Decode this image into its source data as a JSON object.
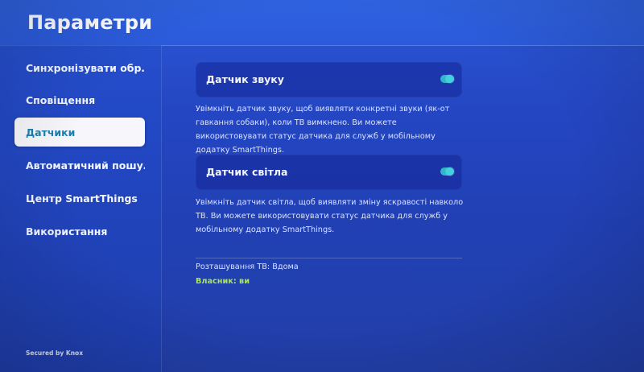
{
  "header": {
    "title": "Параметри"
  },
  "sidebar": {
    "items": [
      {
        "label": "Синхронізувати обр…",
        "selected": false
      },
      {
        "label": "Сповіщення",
        "selected": false
      },
      {
        "label": "Датчики",
        "selected": true
      },
      {
        "label": "Автоматичний пошу…",
        "selected": false
      },
      {
        "label": "Центр SmartThings",
        "selected": false
      },
      {
        "label": "Використання",
        "selected": false
      }
    ],
    "footer": "Secured by Knox"
  },
  "main": {
    "sound_sensor": {
      "label": "Датчик звуку",
      "enabled": true,
      "description": "Увімкніть датчик звуку, щоб виявляти конкретні звуки (як-от гавкання собаки), коли ТВ вимкнено. Ви можете використовувати статус датчика для служб у мобільному додатку SmartThings."
    },
    "light_sensor": {
      "label": "Датчик світла",
      "enabled": true,
      "description": "Увімкніть датчик світла, щоб виявляти зміну яскравості навколо ТВ. Ви можете використовувати статус датчика для служб у мобільному додатку SmartThings."
    },
    "tv_location": "Розташування ТВ: Вдома",
    "owner": "Власник: ви"
  },
  "colors": {
    "background": "#2446c3",
    "accent_toggle": "#43d1e0",
    "selected_text": "#1b7fae",
    "owner_text": "#a8e35a"
  },
  "icons": {
    "toggle": "toggle-switch-on"
  }
}
